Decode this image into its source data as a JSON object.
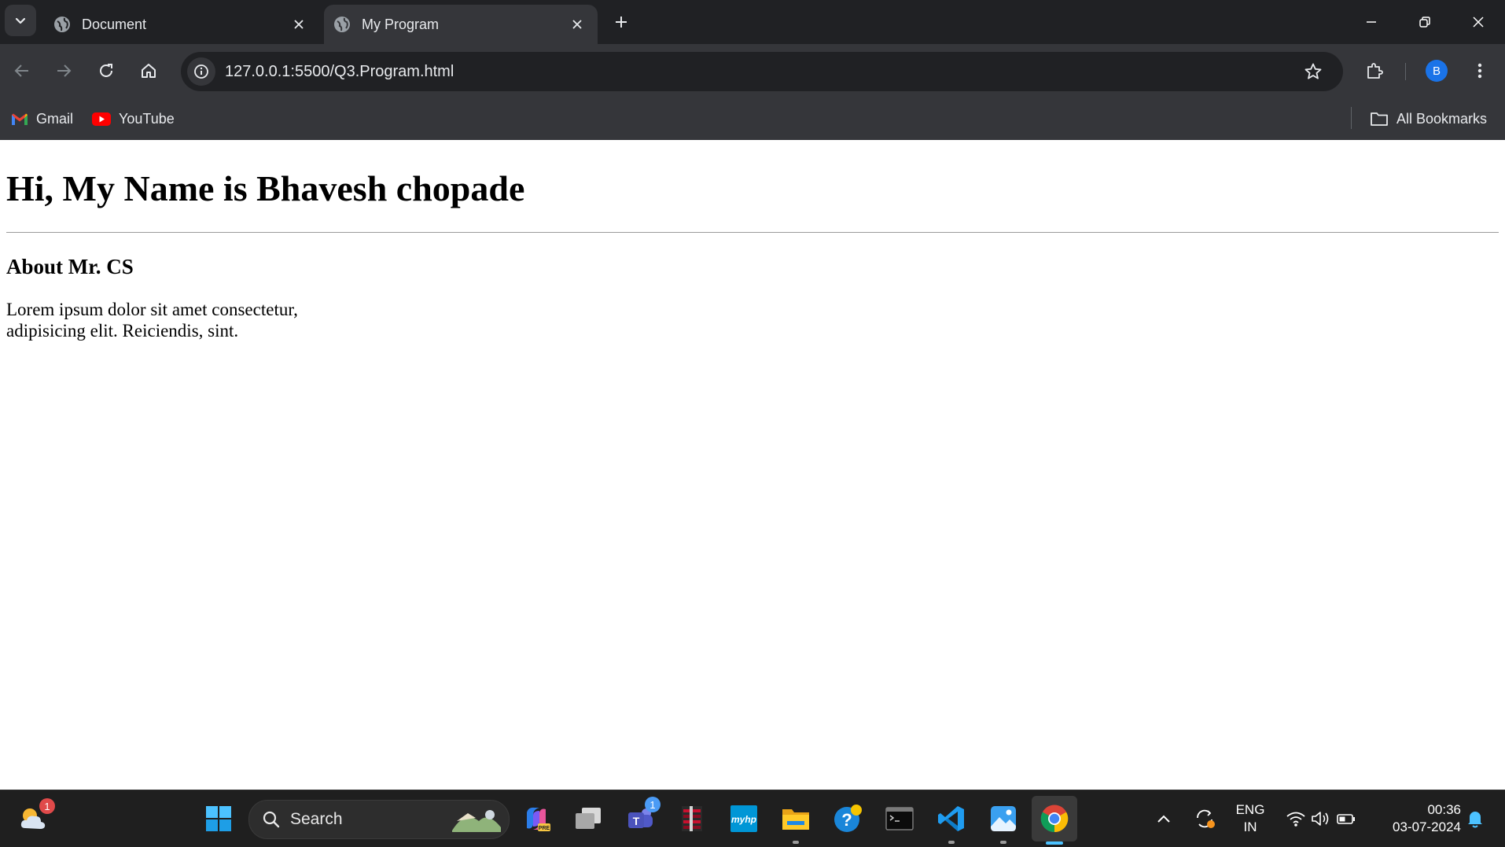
{
  "browser": {
    "tabs": [
      {
        "title": "Document",
        "active": false
      },
      {
        "title": "My Program",
        "active": true
      }
    ],
    "address_bar": {
      "url": "127.0.0.1:5500/Q3.Program.html"
    },
    "profile_initial": "B",
    "bookmarks": [
      {
        "label": "Gmail",
        "icon": "gmail-icon"
      },
      {
        "label": "YouTube",
        "icon": "youtube-icon"
      }
    ],
    "all_bookmarks_label": "All Bookmarks"
  },
  "page": {
    "heading": "Hi, My Name is Bhavesh chopade",
    "subheading": "About Mr. CS",
    "paragraph": "Lorem ipsum dolor sit amet consectetur, adipisicing elit. Reiciendis, sint."
  },
  "taskbar": {
    "weather_badge": "1",
    "search_placeholder": "Search",
    "teams_badge": "1",
    "apps": [
      "windows-start",
      "copilot",
      "task-view",
      "teams",
      "winrar",
      "myhp",
      "file-explorer",
      "help",
      "terminal",
      "vscode",
      "photos",
      "chrome"
    ],
    "language": {
      "line1": "ENG",
      "line2": "IN"
    },
    "time": "00:36",
    "date": "03-07-2024"
  },
  "colors": {
    "titlebar": "#202124",
    "toolbar": "#35363a",
    "accent": "#1a73e8",
    "taskbar": "#1f1f1f"
  }
}
